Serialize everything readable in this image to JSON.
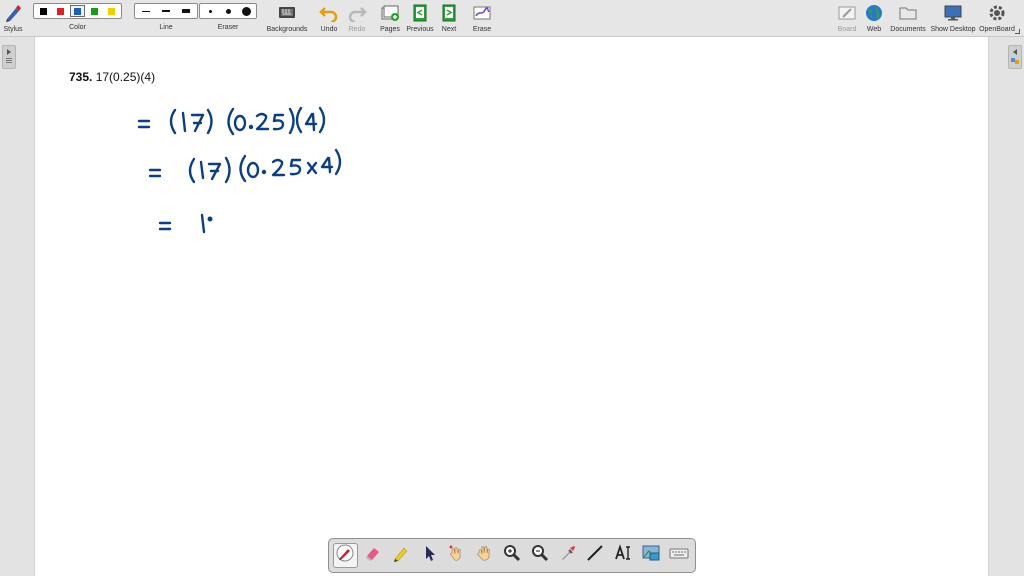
{
  "toolbar": {
    "stylus_label": "Stylus",
    "color_label": "Color",
    "line_label": "Line",
    "eraser_label": "Eraser",
    "backgrounds_label": "Backgrounds",
    "undo_label": "Undo",
    "redo_label": "Redo",
    "pages_label": "Pages",
    "previous_label": "Previous",
    "next_label": "Next",
    "erase_label": "Erase",
    "board_label": "Board",
    "web_label": "Web",
    "documents_label": "Documents",
    "show_desktop_label": "Show Desktop",
    "openboard_label": "OpenBoard",
    "colors": [
      "#000000",
      "#e02020",
      "#1f5fb0",
      "#1a9a1a",
      "#f0d000"
    ],
    "selected_color_index": 2
  },
  "page": {
    "problem_number": "735.",
    "problem_text": "17(0.25)(4)",
    "ink_color": "#0d3f7f"
  },
  "floating_toolbar": {
    "tools": [
      "pen-icon",
      "eraser-icon",
      "highlighter-icon",
      "pointer-icon",
      "laser-pointer-icon",
      "hand-icon",
      "zoom-in-icon",
      "zoom-out-icon",
      "pipette-icon",
      "line-icon",
      "text-icon",
      "capture-icon",
      "keyboard-icon"
    ],
    "selected_index": 0
  }
}
